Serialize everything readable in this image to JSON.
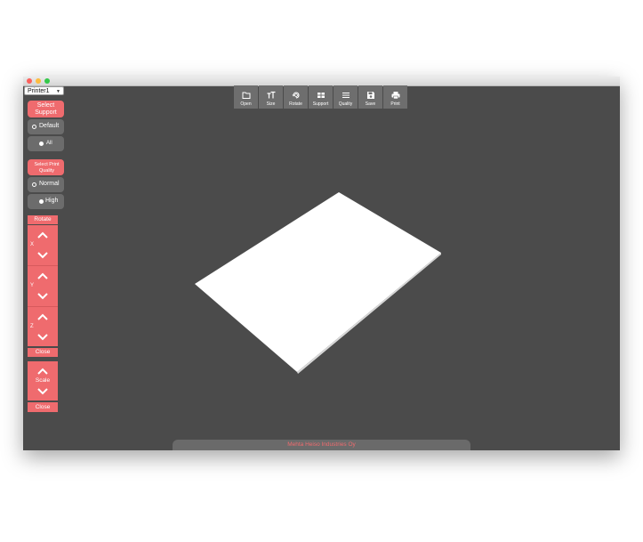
{
  "window": {
    "printer_select": "Printer1"
  },
  "sidebar": {
    "select_support": "Select Support",
    "support_options": [
      "Default",
      "All"
    ],
    "select_print_quality": "Select Print Quality",
    "quality_options": [
      "Normal",
      "High"
    ],
    "rotate": {
      "title": "Rotate",
      "axes": [
        "X",
        "Y",
        "Z"
      ],
      "close": "Close"
    },
    "scale": {
      "label": "Scale",
      "close": "Close"
    }
  },
  "toolbar": {
    "items": [
      {
        "label": "Open",
        "icon": "folder-icon"
      },
      {
        "label": "Size",
        "icon": "text-size-icon"
      },
      {
        "label": "Rotate",
        "icon": "rotate-icon"
      },
      {
        "label": "Support",
        "icon": "support-grid-icon"
      },
      {
        "label": "Quality",
        "icon": "lines-icon"
      },
      {
        "label": "Save",
        "icon": "floppy-icon"
      },
      {
        "label": "Print",
        "icon": "printer-icon"
      }
    ]
  },
  "status_bar": "Mehta Heiso Industries Oy",
  "colors": {
    "accent": "#ef6b6e",
    "background": "#4b4b4b",
    "panel": "#6c6c6c"
  }
}
